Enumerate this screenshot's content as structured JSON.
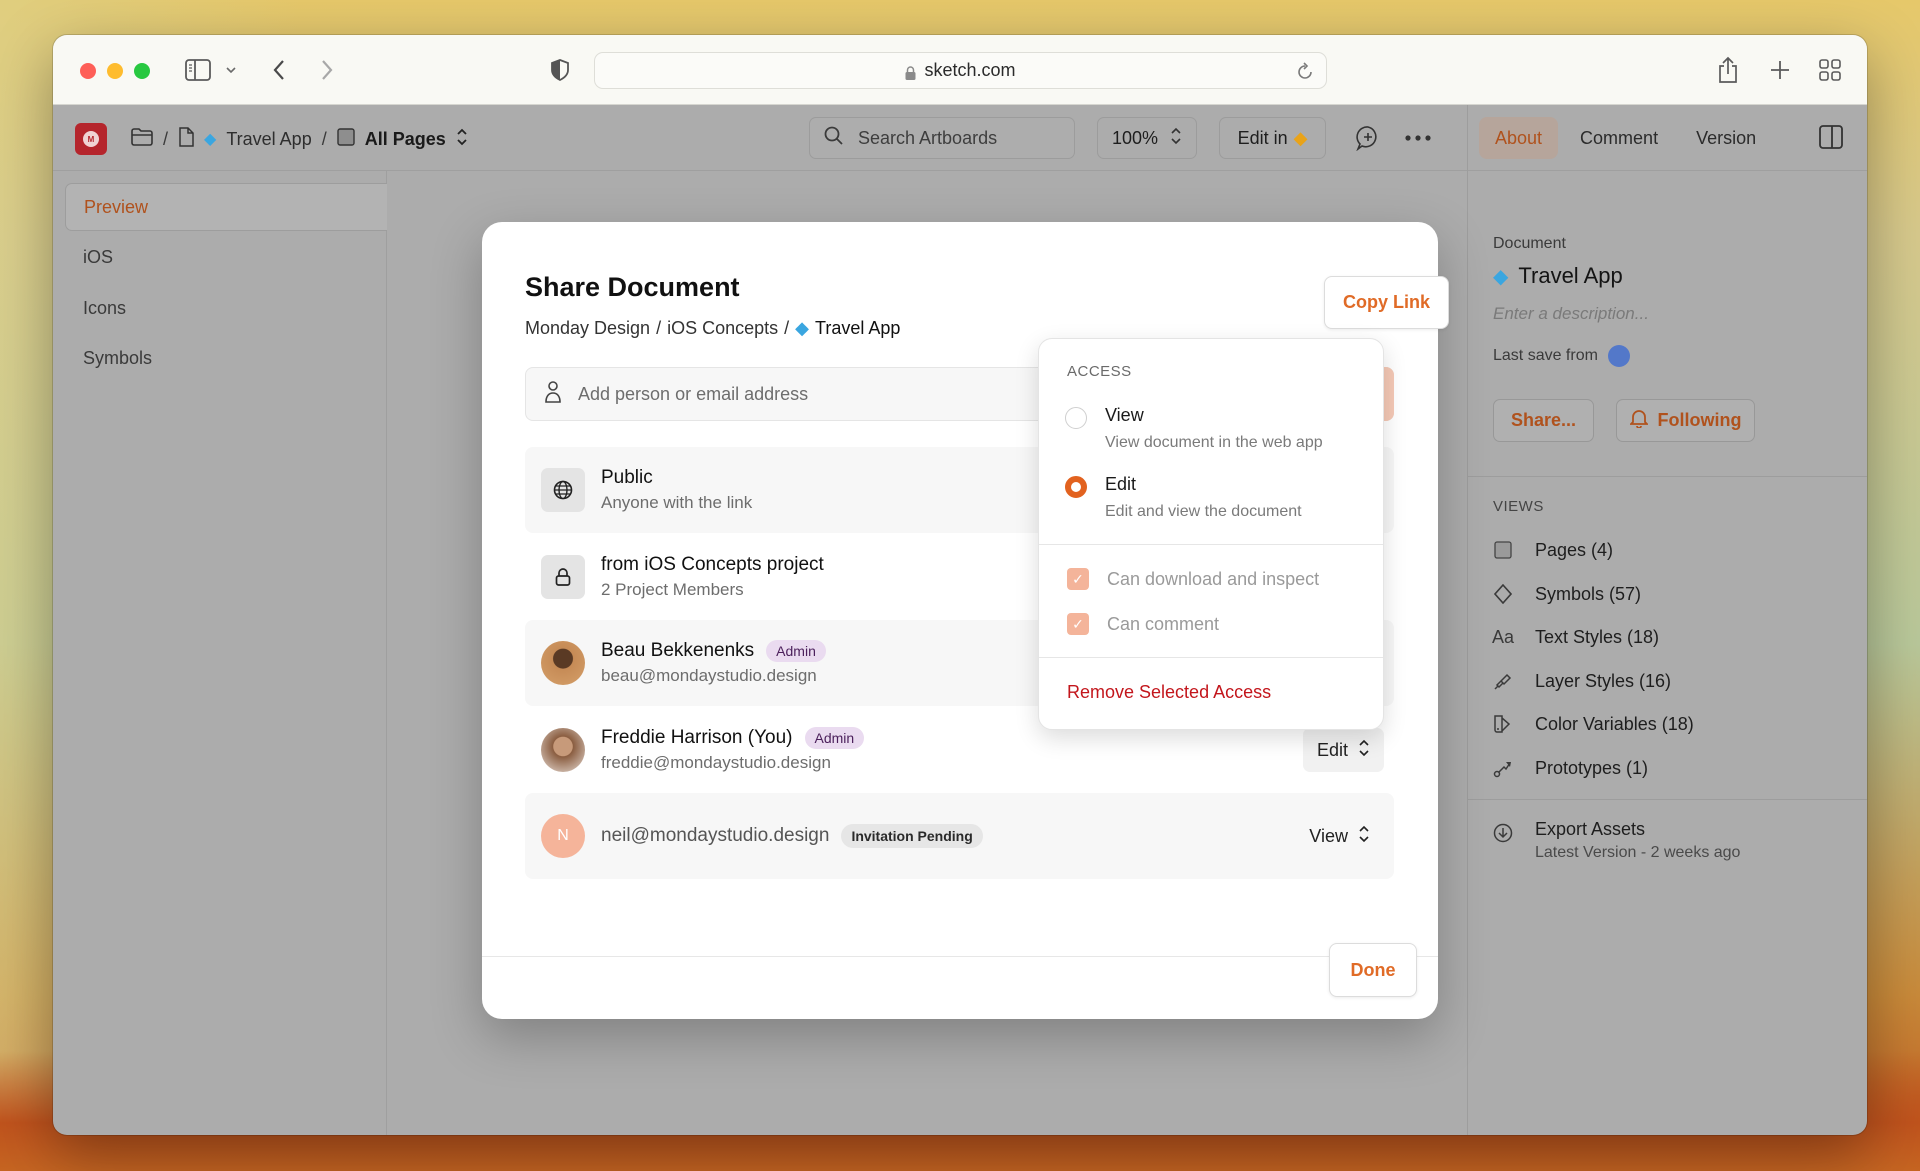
{
  "browser": {
    "url": "sketch.com"
  },
  "toolbar": {
    "breadcrumb": {
      "document": "Travel App",
      "pages": "All Pages"
    },
    "search_placeholder": "Search Artboards",
    "zoom": "100%",
    "edit_in": "Edit in",
    "tabs": [
      {
        "label": "About",
        "active": true
      },
      {
        "label": "Comment",
        "active": false
      },
      {
        "label": "Version",
        "active": false
      }
    ]
  },
  "sidebar": {
    "items": [
      {
        "label": "Preview",
        "active": true
      },
      {
        "label": "iOS",
        "active": false
      },
      {
        "label": "Icons",
        "active": false
      },
      {
        "label": "Symbols",
        "active": false
      }
    ]
  },
  "right_panel": {
    "section_label": "Document",
    "title": "Travel App",
    "description_placeholder": "Enter a description...",
    "last_save": "Last save from",
    "share_button": "Share...",
    "following_button": "Following",
    "views_label": "VIEWS",
    "views": [
      {
        "label": "Pages (4)",
        "icon": "pages-icon"
      },
      {
        "label": "Symbols (57)",
        "icon": "symbol-diamond-icon"
      },
      {
        "label": "Text Styles (18)",
        "icon": "text-style-icon"
      },
      {
        "label": "Layer Styles (16)",
        "icon": "brush-icon"
      },
      {
        "label": "Color Variables (18)",
        "icon": "color-variable-icon"
      },
      {
        "label": "Prototypes (1)",
        "icon": "prototype-icon"
      }
    ],
    "export": {
      "title": "Export Assets",
      "subtitle": "Latest Version - 2 weeks ago"
    }
  },
  "modal": {
    "title": "Share Document",
    "breadcrumb": [
      "Monday Design",
      "iOS Concepts",
      "Travel App"
    ],
    "copy_link": "Copy Link",
    "add_placeholder": "Add person or email address",
    "rows": [
      {
        "name": "Public",
        "sub": "Anyone with the link"
      },
      {
        "name": "from iOS Concepts project",
        "sub": "2 Project Members"
      },
      {
        "name": "Beau Bekkenenks",
        "badge": "Admin",
        "sub": "beau@mondaystudio.design"
      },
      {
        "name": "Freddie Harrison (You)",
        "badge": "Admin",
        "sub": "freddie@mondaystudio.design",
        "permission": "Edit"
      },
      {
        "initial": "N",
        "email": "neil@mondaystudio.design",
        "badge": "Invitation Pending",
        "permission": "View"
      }
    ],
    "done": "Done"
  },
  "access_popover": {
    "label": "ACCESS",
    "options": [
      {
        "title": "View",
        "desc": "View document in the web app",
        "selected": false
      },
      {
        "title": "Edit",
        "desc": "Edit and view the document",
        "selected": true
      }
    ],
    "checks": [
      {
        "label": "Can download and inspect",
        "checked": true
      },
      {
        "label": "Can comment",
        "checked": true
      }
    ],
    "remove": "Remove Selected Access"
  },
  "colors": {
    "accent": "#e06b27",
    "danger": "#c3161c",
    "admin_badge": "#eadbf0"
  }
}
